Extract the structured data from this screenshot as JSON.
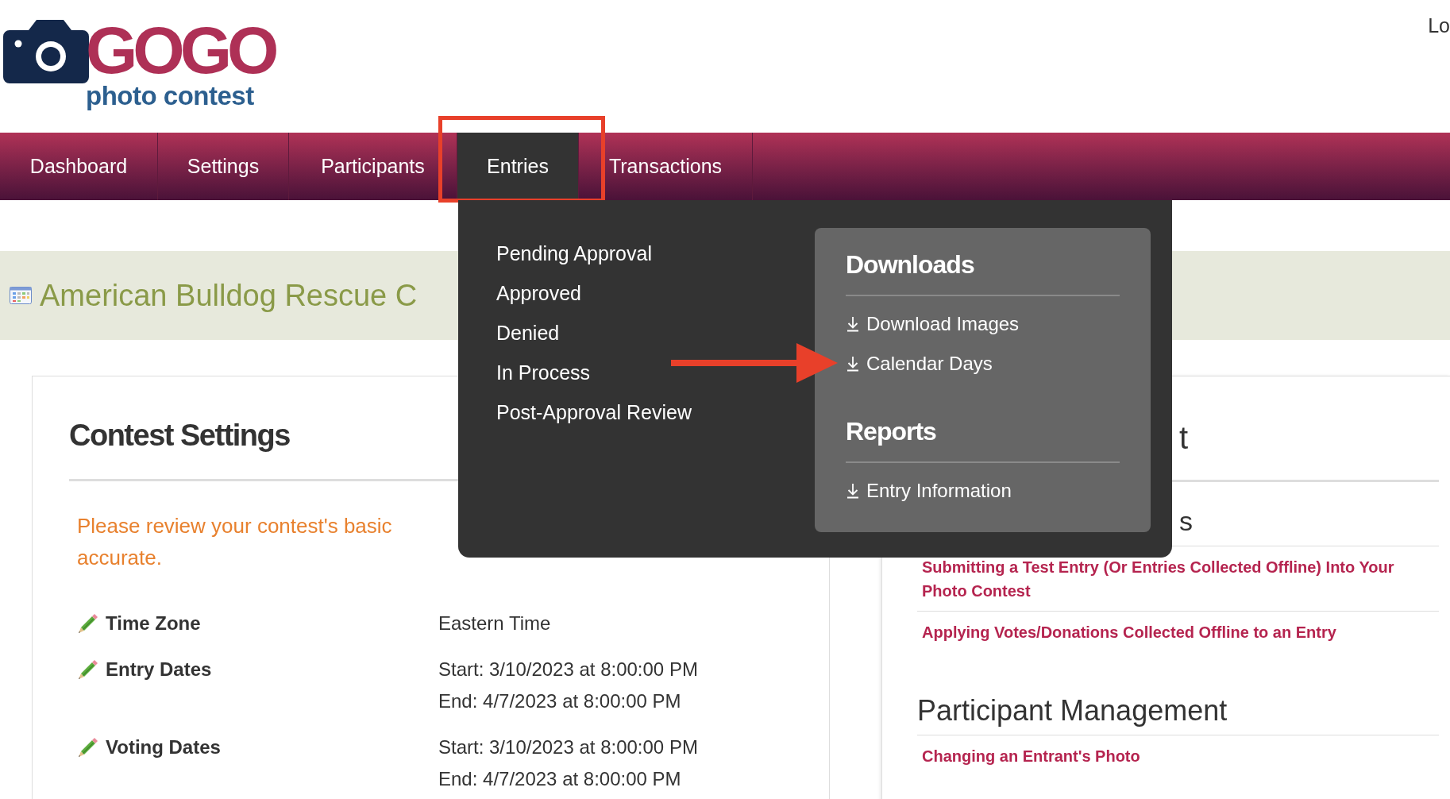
{
  "logo": {
    "wordmark": "GOGO",
    "tagline": "photo contest"
  },
  "header_link": "Lo",
  "nav": [
    {
      "label": "Dashboard",
      "selected": false
    },
    {
      "label": "Settings",
      "selected": false
    },
    {
      "label": "Participants",
      "selected": false
    },
    {
      "label": "Entries",
      "selected": true
    },
    {
      "label": "Transactions",
      "selected": false
    }
  ],
  "entries_menu": {
    "items": [
      "Pending Approval",
      "Approved",
      "Denied",
      "In Process",
      "Post-Approval Review"
    ],
    "sections": [
      {
        "title": "Downloads",
        "items": [
          "Download Images",
          "Calendar Days"
        ]
      },
      {
        "title": "Reports",
        "items": [
          "Entry Information"
        ]
      }
    ]
  },
  "banner": {
    "title": "American Bulldog Rescue C"
  },
  "contest_settings": {
    "title": "Contest Settings",
    "notice_lines": [
      "Please review your contest's basic",
      "accurate."
    ],
    "rows": [
      {
        "label": "Time Zone",
        "values": [
          "Eastern Time"
        ]
      },
      {
        "label": "Entry Dates",
        "values": [
          "Start: 3/10/2023 at 8:00:00 PM",
          "End: 4/7/2023 at 8:00:00 PM"
        ]
      },
      {
        "label": "Voting Dates",
        "values": [
          "Start: 3/10/2023 at 8:00:00 PM",
          "End: 4/7/2023 at 8:00:00 PM"
        ]
      }
    ]
  },
  "help": {
    "title": "t",
    "groups": [
      {
        "kind": "partial",
        "heading": "s",
        "links": [
          "Submitting a Test Entry (Or Entries Collected Offline) Into Your Photo Contest",
          "Applying Votes/Donations Collected Offline to an Entry"
        ]
      },
      {
        "kind": "full",
        "heading": "Participant Management",
        "links": [
          "Changing an Entrant's Photo"
        ]
      }
    ]
  }
}
